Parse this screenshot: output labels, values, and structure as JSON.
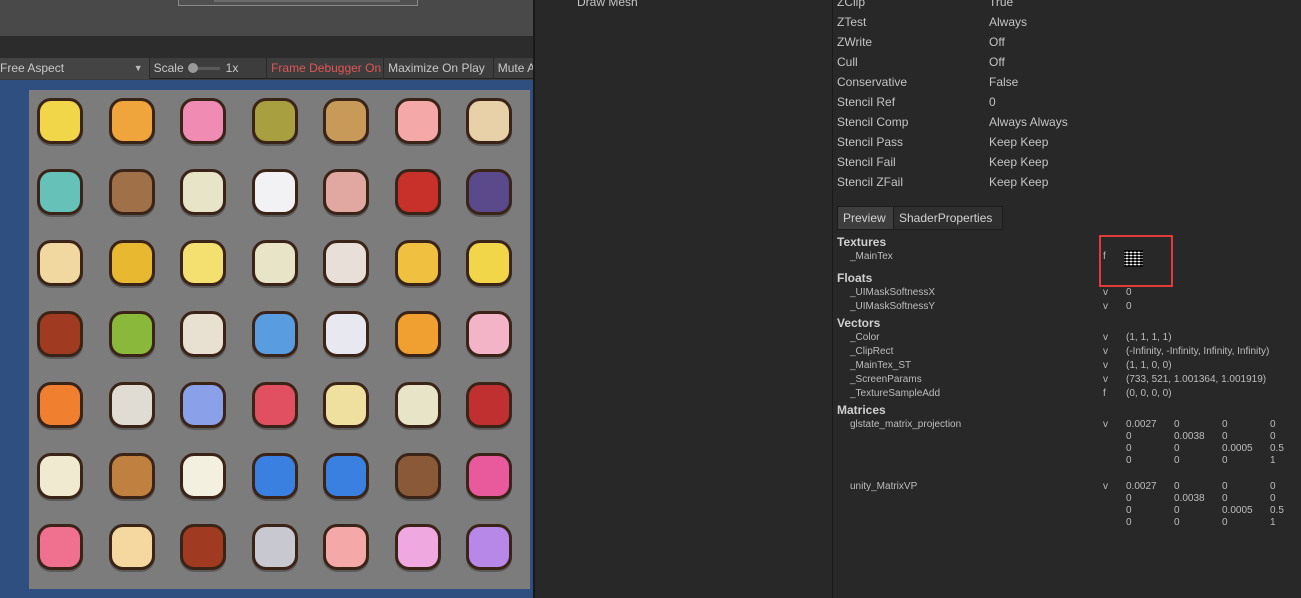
{
  "game_view": {
    "toolbar": {
      "aspect": "Free Aspect",
      "scale_label": "Scale",
      "scale_value": "1x",
      "frame_debugger": "Frame Debugger On",
      "maximize_on_play": "Maximize On Play",
      "mute_audio": "Mute Audio"
    },
    "items": [
      [
        "yellow-sheep-icon",
        "strawberry-box-icon",
        "halo-mushroom-icon",
        "soup-bowl-icon",
        "paintbrush-icon",
        "pink-candy-icon",
        "ram-face-icon"
      ],
      [
        "knitting-basket-icon",
        "sickle-icon",
        "tea-cup-icon",
        "angel-wing-icon",
        "bow-icon",
        "red-flame-icon",
        "cat-cape-icon"
      ],
      [
        "choco-donut-icon",
        "gold-bar-icon",
        "potion-bottle-icon",
        "tea-cup-icon",
        "bone-bow-icon",
        "golden-cross-bear-icon",
        "yellow-sheep-icon"
      ],
      [
        "red-rope-icon",
        "kiwi-icon",
        "cookie-ball-icon",
        "blue-shirt-icon",
        "white-bunny-icon",
        "cupcake-icon",
        "ice-cream-cup-icon"
      ],
      [
        "orange-jelly-icon",
        "grey-sheep-icon",
        "blue-cloud-icon",
        "crown-book-icon",
        "halo-scroll-icon",
        "tea-cup-icon",
        "red-ribbon-icon"
      ],
      [
        "white-snake-icon",
        "toast-face-icon",
        "folded-letter-icon",
        "blue-star-icon",
        "blue-star-icon",
        "dirt-pile-icon",
        "candy-jar-icon"
      ],
      [
        "pink-eraser-icon",
        "bread-icon",
        "red-rope-icon",
        "needle-icon",
        "pink-candy-icon",
        "pink-flower-icon",
        "purple-drink-icon"
      ]
    ],
    "item_colors": [
      [
        "#f2d64a",
        "#f0a43c",
        "#f08cb4",
        "#a8a040",
        "#c89a5a",
        "#f5a8a8",
        "#e8d0a8"
      ],
      [
        "#66c2b8",
        "#a07048",
        "#e8e4c8",
        "#f2f2f4",
        "#e0a8a0",
        "#c8302a",
        "#5a4a8c"
      ],
      [
        "#f0d8a0",
        "#e8b830",
        "#f4e070",
        "#e8e4c8",
        "#e8e0d8",
        "#f0c040",
        "#f2d64a"
      ],
      [
        "#a03a20",
        "#8ab83a",
        "#e8e0d0",
        "#5a9ce0",
        "#e8e8f0",
        "#f0a030",
        "#f4b4c8"
      ],
      [
        "#f08030",
        "#e0dcd4",
        "#8aa0e8",
        "#e05060",
        "#f0e0a0",
        "#e8e4c8",
        "#c03030"
      ],
      [
        "#f0ead0",
        "#c08040",
        "#f4f0e0",
        "#3a80e0",
        "#3a80e0",
        "#8a5a38",
        "#e85a9c"
      ],
      [
        "#f07090",
        "#f4d8a0",
        "#a03a20",
        "#c8c8d0",
        "#f5a8a8",
        "#f0a8e0",
        "#b888e8"
      ]
    ]
  },
  "event_list": {
    "selected_event": "Draw Mesh"
  },
  "details": {
    "state": [
      {
        "key": "ZClip",
        "value": "True"
      },
      {
        "key": "ZTest",
        "value": "Always"
      },
      {
        "key": "ZWrite",
        "value": "Off"
      },
      {
        "key": "Cull",
        "value": "Off"
      },
      {
        "key": "Conservative",
        "value": "False"
      },
      {
        "key": "Stencil Ref",
        "value": "0"
      },
      {
        "key": "Stencil Comp",
        "value": "Always Always"
      },
      {
        "key": "Stencil Pass",
        "value": "Keep Keep"
      },
      {
        "key": "Stencil Fail",
        "value": "Keep Keep"
      },
      {
        "key": "Stencil ZFail",
        "value": "Keep Keep"
      }
    ],
    "tabs": [
      "Preview",
      "ShaderProperties"
    ],
    "sections": {
      "textures": "Textures",
      "floats": "Floats",
      "vectors": "Vectors",
      "matrices": "Matrices"
    },
    "textures": [
      {
        "name": "_MainTex",
        "type": "f"
      }
    ],
    "floats": [
      {
        "name": "_UIMaskSoftnessX",
        "type": "v",
        "value": "0"
      },
      {
        "name": "_UIMaskSoftnessY",
        "type": "v",
        "value": "0"
      }
    ],
    "vectors": [
      {
        "name": "_Color",
        "type": "v",
        "value": "(1, 1, 1, 1)"
      },
      {
        "name": "_ClipRect",
        "type": "v",
        "value": "(-Infinity, -Infinity, Infinity, Infinity)"
      },
      {
        "name": "_MainTex_ST",
        "type": "v",
        "value": "(1, 1, 0, 0)"
      },
      {
        "name": "_ScreenParams",
        "type": "v",
        "value": "(733, 521, 1.001364, 1.001919)"
      },
      {
        "name": "_TextureSampleAdd",
        "type": "f",
        "value": "(0, 0, 0, 0)"
      }
    ],
    "matrices": [
      {
        "name": "glstate_matrix_projection",
        "type": "v",
        "rows": [
          [
            "0.0027",
            "0",
            "0",
            "0"
          ],
          [
            "0",
            "0.0038",
            "0",
            "0"
          ],
          [
            "0",
            "0",
            "0.0005",
            "0.5"
          ],
          [
            "0",
            "0",
            "0",
            "1"
          ]
        ]
      },
      {
        "name": "unity_MatrixVP",
        "type": "v",
        "rows": [
          [
            "0.0027",
            "0",
            "0",
            "0"
          ],
          [
            "0",
            "0.0038",
            "0",
            "0"
          ],
          [
            "0",
            "0",
            "0.0005",
            "0.5"
          ],
          [
            "0",
            "0",
            "0",
            "1"
          ]
        ]
      }
    ],
    "highlight_color": "#e03a3a"
  }
}
